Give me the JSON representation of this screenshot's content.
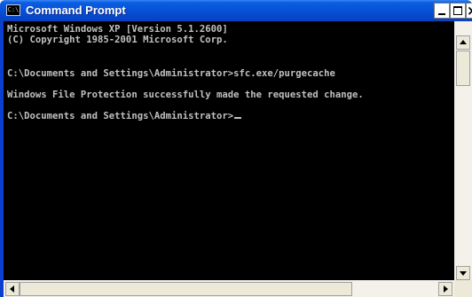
{
  "window": {
    "title": "Command Prompt",
    "icon": "console-icon",
    "icon_glyph": "C:\\",
    "close_glyph": "×"
  },
  "console": {
    "lines": [
      "Microsoft Windows XP [Version 5.1.2600]",
      "(C) Copyright 1985-2001 Microsoft Corp.",
      "",
      "C:\\Documents and Settings\\Administrator>sfc.exe/purgecache",
      "",
      "Windows File Protection successfully made the requested change.",
      "",
      "C:\\Documents and Settings\\Administrator>"
    ]
  },
  "colors": {
    "console_background": "#000000",
    "console_text": "#c0c0c0",
    "titlebar": "#0750d8"
  }
}
